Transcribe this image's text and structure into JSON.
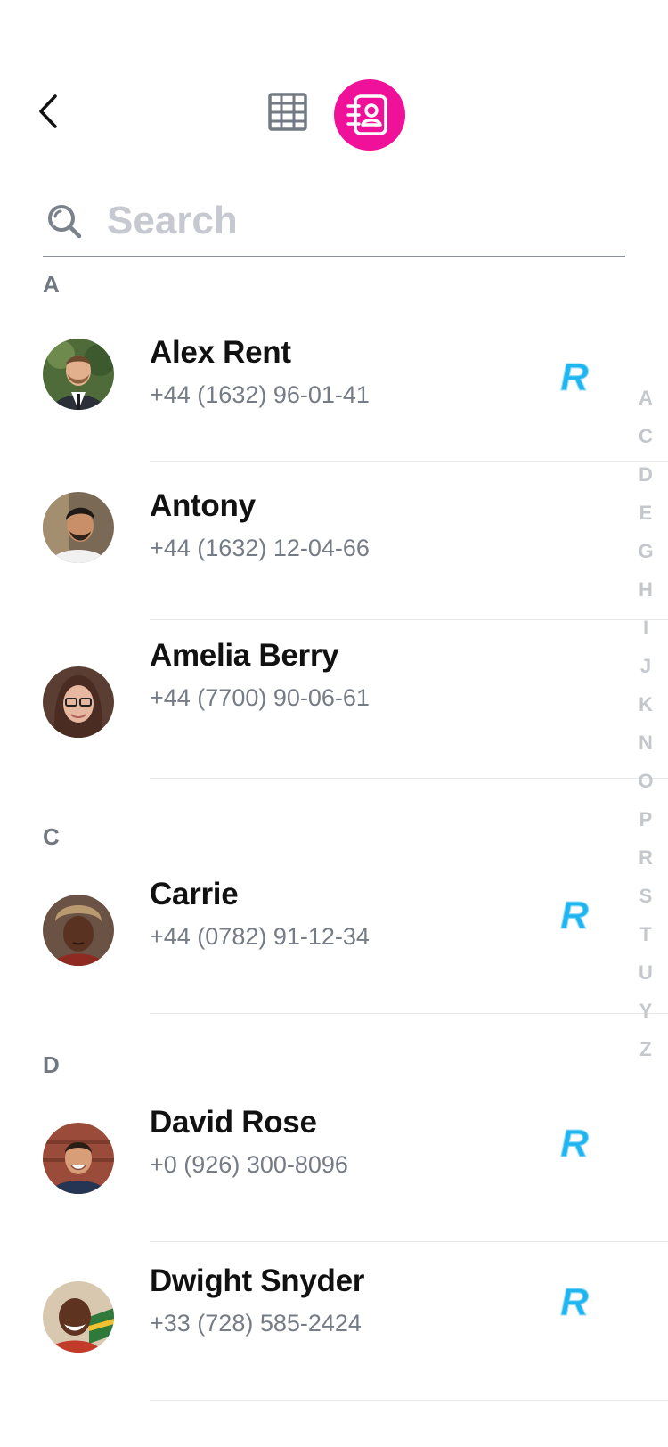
{
  "header": {
    "back_icon": "chevron-left-icon",
    "tabs": [
      {
        "name": "keypad",
        "icon": "keypad-grid-icon",
        "active": false
      },
      {
        "name": "contacts",
        "icon": "contact-book-icon",
        "active": true
      }
    ],
    "accent_color": "#f0119a"
  },
  "search": {
    "placeholder": "Search",
    "value": ""
  },
  "sections": [
    {
      "letter": "A",
      "contacts": [
        {
          "name": "Alex Rent",
          "phone": "+44 (1632) 96-01-41",
          "revolut": true
        },
        {
          "name": "Antony",
          "phone": "+44 (1632) 12-04-66",
          "revolut": false
        },
        {
          "name": "Amelia Berry",
          "phone": "+44 (7700) 90-06-61",
          "revolut": false
        }
      ]
    },
    {
      "letter": "C",
      "contacts": [
        {
          "name": "Carrie",
          "phone": "+44 (0782) 91-12-34",
          "revolut": true
        }
      ]
    },
    {
      "letter": "D",
      "contacts": [
        {
          "name": "David Rose",
          "phone": "+0 (926) 300-8096",
          "revolut": true
        },
        {
          "name": "Dwight Snyder",
          "phone": "+33 (728) 585-2424",
          "revolut": true
        }
      ]
    }
  ],
  "alphabet_index": [
    "A",
    "C",
    "D",
    "E",
    "G",
    "H",
    "I",
    "J",
    "K",
    "N",
    "O",
    "P",
    "R",
    "S",
    "T",
    "U",
    "Y",
    "Z"
  ],
  "colors": {
    "revolut_badge": "#1fb5f0",
    "secondary_text": "#767c85",
    "section_header": "#717882",
    "index_letters": "#c4c8cd"
  }
}
